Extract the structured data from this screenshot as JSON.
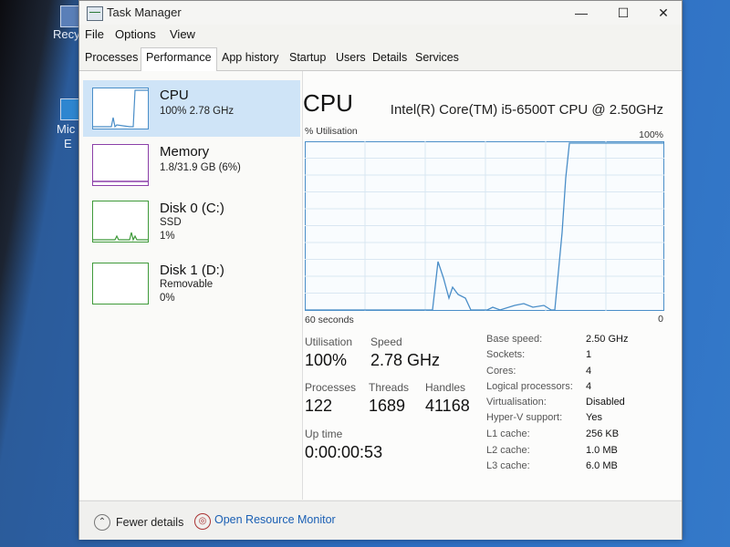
{
  "window": {
    "title": "Task Manager",
    "minimize": "—",
    "maximize": "☐",
    "close": "✕"
  },
  "desktop": {
    "recycle_label": "Recy",
    "edge_label_1": "Mic",
    "edge_label_2": "E"
  },
  "menu": [
    "File",
    "Options",
    "View"
  ],
  "tabs": [
    "Processes",
    "Performance",
    "App history",
    "Startup",
    "Users",
    "Details",
    "Services"
  ],
  "active_tab": "Performance",
  "resources": [
    {
      "name": "CPU",
      "line1": "100%  2.78 GHz",
      "line2": ""
    },
    {
      "name": "Memory",
      "line1": "1.8/31.9 GB (6%)",
      "line2": ""
    },
    {
      "name": "Disk 0 (C:)",
      "line1": "SSD",
      "line2": "1%"
    },
    {
      "name": "Disk 1 (D:)",
      "line1": "Removable",
      "line2": "0%"
    }
  ],
  "cpu_panel": {
    "title": "CPU",
    "model": "Intel(R) Core(TM) i5-6500T CPU @ 2.50GHz",
    "graph_label": "% Utilisation",
    "graph_max": "100%",
    "graph_time": "60 seconds",
    "graph_min": "0",
    "utilisation_label": "Utilisation",
    "utilisation_value": "100%",
    "speed_label": "Speed",
    "speed_value": "2.78 GHz",
    "processes_label": "Processes",
    "processes_value": "122",
    "threads_label": "Threads",
    "threads_value": "1689",
    "handles_label": "Handles",
    "handles_value": "41168",
    "uptime_label": "Up time",
    "uptime_value": "0:00:00:53",
    "specs": [
      {
        "label": "Base speed:",
        "value": "2.50 GHz"
      },
      {
        "label": "Sockets:",
        "value": "1"
      },
      {
        "label": "Cores:",
        "value": "4"
      },
      {
        "label": "Logical processors:",
        "value": "4"
      },
      {
        "label": "Virtualisation:",
        "value": "Disabled"
      },
      {
        "label": "Hyper-V support:",
        "value": "Yes"
      },
      {
        "label": "L1 cache:",
        "value": "256 KB"
      },
      {
        "label": "L2 cache:",
        "value": "1.0 MB"
      },
      {
        "label": "L3 cache:",
        "value": "6.0 MB"
      }
    ]
  },
  "footer": {
    "fewer_details": "Fewer details",
    "open_monitor": "Open Resource Monitor"
  },
  "colors": {
    "cpu_line": "#4a8ec8",
    "memory_line": "#8b3fa8",
    "disk_line": "#3f9a3a",
    "link": "#1a5fb4"
  }
}
